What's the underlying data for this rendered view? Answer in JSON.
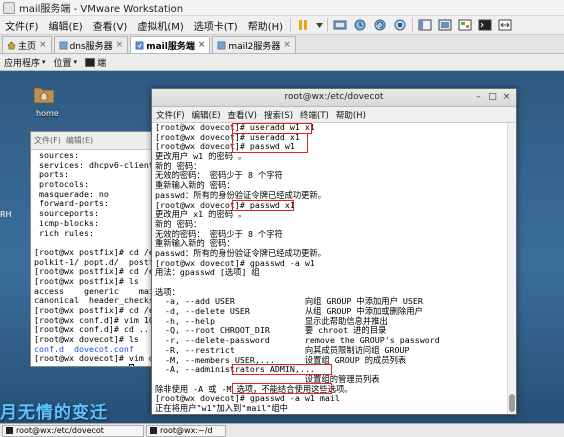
{
  "vmware": {
    "window_title": "mail服务端 - VMware Workstation",
    "menu": [
      "文件(F)",
      "编辑(E)",
      "查看(V)",
      "虚拟机(M)",
      "选项卡(T)",
      "帮助(H)"
    ],
    "tabs": [
      {
        "label": "主页",
        "active": false
      },
      {
        "label": "dns服务器",
        "active": false
      },
      {
        "label": "mail服务端",
        "active": true
      },
      {
        "label": "mail2服务器",
        "active": false
      }
    ]
  },
  "guest_panel": {
    "applications": "应用程序",
    "places": "位置",
    "window_item": "端"
  },
  "desktop": {
    "home_label": "home",
    "rh_label": "RH",
    "wallpaper_text": "月无情的变迁"
  },
  "term_back": {
    "menu": [
      "文件(F)",
      "编辑(E)"
    ],
    "lines": [
      {
        "text": " sources:",
        "color": "normal"
      },
      {
        "text": " services: dhcpv6-client dns",
        "color": "normal"
      },
      {
        "text": " ports:",
        "color": "normal"
      },
      {
        "text": " protocols:",
        "color": "normal"
      },
      {
        "text": " masquerade: no",
        "color": "normal"
      },
      {
        "text": " forward-ports:",
        "color": "normal"
      },
      {
        "text": " sourceports:",
        "color": "normal"
      },
      {
        "text": " icmp-blocks:",
        "color": "normal"
      },
      {
        "text": " rich rules:",
        "color": "normal"
      },
      {
        "text": "",
        "color": "normal"
      },
      {
        "text": "[root@wx postfix]# cd /etc/",
        "color": "normal"
      },
      {
        "text": "polkit-1/ popt.d/  postfix/",
        "color": "normal"
      },
      {
        "text": "[root@wx postfix]# cd /etc/",
        "color": "normal"
      },
      {
        "text": "[root@wx postfix]# ls",
        "color": "normal"
      },
      {
        "text": "access    generic    main",
        "color": "normal"
      },
      {
        "text": "canonical  header_checks  m",
        "color": "normal"
      },
      {
        "text": "[root@wx postfix]# cd /etc/",
        "color": "normal"
      },
      {
        "text": "[root@wx conf.d]# vim 10-ma",
        "color": "normal"
      },
      {
        "text": "[root@wx conf.d]# cd ..",
        "color": "normal"
      },
      {
        "text": "[root@wx dovecot]# ls",
        "color": "normal"
      },
      {
        "text": "conf.d  dovecot.conf",
        "color": "blue"
      },
      {
        "text": "[root@wx dovecot]# vim dove",
        "color": "normal"
      },
      {
        "text": "[root@wx dovecot]# ",
        "color": "normal"
      }
    ]
  },
  "term_front": {
    "title": "root@wx:/etc/dovecot",
    "menu": [
      "文件(F)",
      "编辑(E)",
      "查看(V)",
      "搜索(S)",
      "终端(T)",
      "帮助(H)"
    ],
    "lines": [
      "[root@wx dovecot]# useradd w1 x1",
      "[root@wx dovecot]# useradd x1",
      "[root@wx dovecot]# passwd w1",
      "更改用户 w1 的密码 。",
      "新的 密码：",
      "无效的密码： 密码少于 8 个字符",
      "重新输入新的 密码：",
      "passwd：所有的身份验证令牌已经成功更新。",
      "[root@wx dovecot]# passwd x1",
      "更改用户 x1 的密码 。",
      "新的 密码：",
      "无效的密码： 密码少于 8 个字符",
      "重新输入新的 密码：",
      "passwd：所有的身份验证令牌已经成功更新。",
      "[root@wx dovecot]# gpasswd -a w1",
      "用法：gpasswd [选项] 组",
      "",
      "选项：",
      "  -a, --add USER              向组 GROUP 中添加用户 USER",
      "  -d, --delete USER           从组 GROUP 中添加或删除用户",
      "  -h, --help                  显示此帮助信息并推出",
      "  -Q, --root CHROOT_DIR       要 chroot 进的目录",
      "  -r, --delete-password       remove the GROUP's password",
      "  -R, --restrict              向其成员限制访问组 GROUP",
      "  -M, --members USER,...      设置组 GROUP 的成员列表",
      "  -A, --administrators ADMIN,...",
      "                              设置组的管理员列表",
      "除非使用 -A 或 -M 选项，不能结合使用这些选项。",
      "[root@wx dovecot]# gpasswd -a w1 mail",
      "正在将用户\"w1\"加入到\"mail\"组中",
      "[root@wx dovecot]# gpasswd -a x1 mail",
      "正在将用户\"x1\"加入到\"mail\"组中",
      "[root@wx dovecot]# "
    ]
  },
  "taskbar": {
    "items": [
      "root@wx:/etc/dovecot",
      "root@wx:~/d"
    ]
  }
}
